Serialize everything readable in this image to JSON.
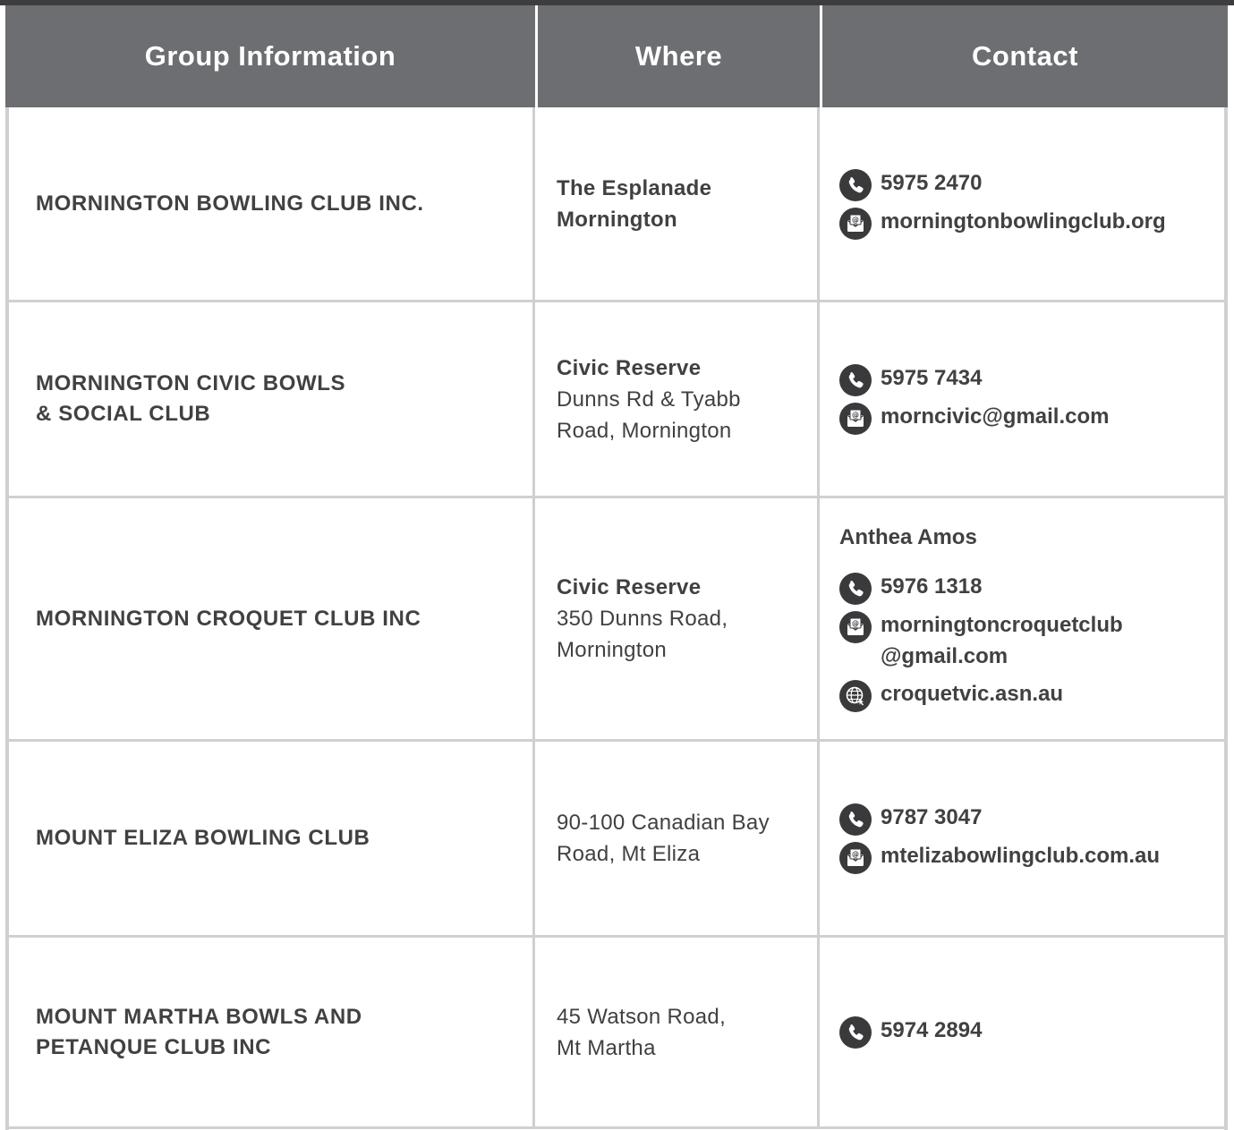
{
  "header": {
    "col_group": "Group Information",
    "col_where": "Where",
    "col_contact": "Contact"
  },
  "rows": [
    {
      "club": [
        "MORNINGTON BOWLING CLUB INC."
      ],
      "where_bold": [
        "The Esplanade",
        "Mornington"
      ],
      "where_plain": [],
      "contact_person": "",
      "phone": "5975 2470",
      "email": [
        "morningtonbowlingclub.org"
      ],
      "web": ""
    },
    {
      "club": [
        "MORNINGTON CIVIC BOWLS",
        "& SOCIAL CLUB"
      ],
      "where_bold": [
        "Civic Reserve"
      ],
      "where_plain": [
        "Dunns Rd & Tyabb",
        "Road, Mornington"
      ],
      "contact_person": "",
      "phone": "5975 7434",
      "email": [
        "morncivic@gmail.com"
      ],
      "web": ""
    },
    {
      "club": [
        "MORNINGTON CROQUET CLUB INC"
      ],
      "where_bold": [
        "Civic Reserve"
      ],
      "where_plain": [
        "350 Dunns Road,",
        "Mornington"
      ],
      "contact_person": "Anthea Amos",
      "phone": "5976 1318",
      "email": [
        "morningtoncroquetclub",
        "@gmail.com"
      ],
      "web": "croquetvic.asn.au"
    },
    {
      "club": [
        "MOUNT ELIZA BOWLING CLUB"
      ],
      "where_bold": [],
      "where_plain": [
        "90-100 Canadian Bay",
        "Road, Mt Eliza"
      ],
      "contact_person": "",
      "phone": "9787 3047",
      "email": [
        "mtelizabowlingclub.com.au"
      ],
      "web": ""
    },
    {
      "club": [
        "MOUNT MARTHA BOWLS AND",
        "PETANQUE CLUB INC"
      ],
      "where_bold": [],
      "where_plain": [
        "45 Watson Road,",
        "Mt Martha"
      ],
      "contact_person": "",
      "phone": "5974 2894",
      "email": [],
      "web": ""
    }
  ],
  "icons": {
    "phone": "phone-icon",
    "email": "email-icon",
    "web": "globe-icon"
  },
  "colors": {
    "header_bg": "#6d6e71",
    "header_text": "#ffffff",
    "text": "#414042",
    "grid": "#d0d0d2",
    "icon_bg": "#3a3a3c"
  }
}
